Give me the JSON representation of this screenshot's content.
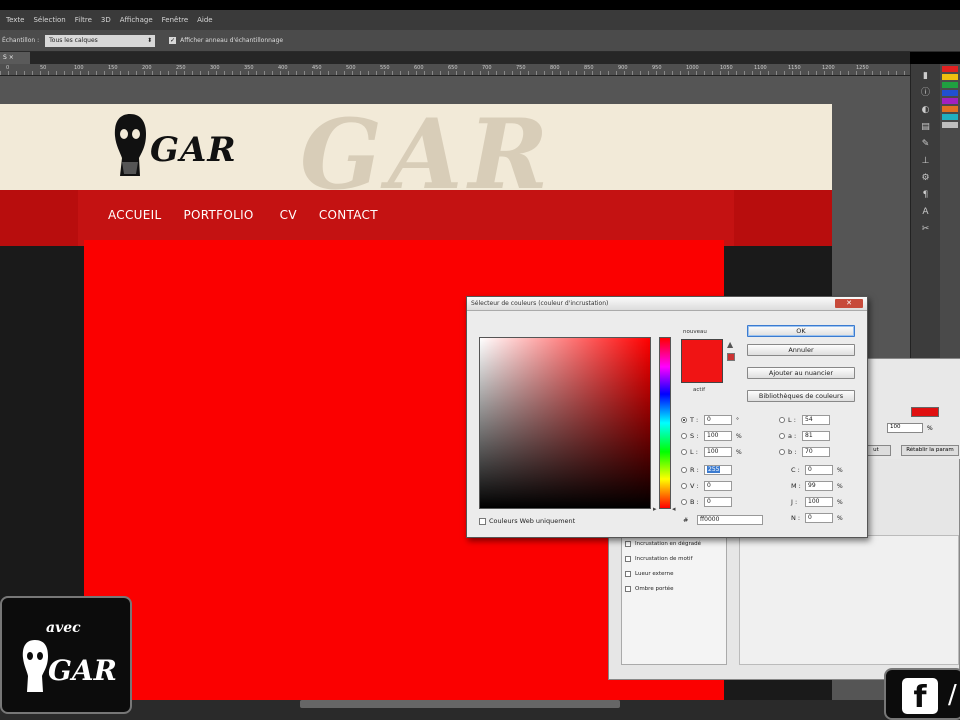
{
  "menubar": [
    "Texte",
    "Sélection",
    "Filtre",
    "3D",
    "Affichage",
    "Fenêtre",
    "Aide"
  ],
  "options": {
    "sample_label": "Échantillon :",
    "sample_value": "Tous les calques",
    "show_ring_label": "Afficher anneau d'échantillonnage"
  },
  "ruler_ticks": [
    "0",
    "50",
    "100",
    "150",
    "200",
    "250",
    "300",
    "350",
    "400",
    "450",
    "500",
    "550",
    "600",
    "650",
    "700",
    "750",
    "800",
    "850",
    "900",
    "950",
    "1000",
    "1050",
    "1100",
    "1150",
    "1200",
    "1250"
  ],
  "site": {
    "ghost_text": "GAR",
    "logo_text": "GAR",
    "nav": [
      "ACCUEIL",
      "PORTFOLIO",
      "CV",
      "CONTACT"
    ]
  },
  "picker": {
    "title": "Sélecteur de couleurs (couleur d'incrustation)",
    "label_new": "nouveau",
    "label_current": "actif",
    "new_color": "#f01414",
    "buttons": {
      "ok": "OK",
      "cancel": "Annuler",
      "add_swatch": "Ajouter au nuancier",
      "libraries": "Bibliothèques de couleurs"
    },
    "fields": {
      "T": {
        "letter": "T :",
        "value": "0",
        "unit": "°"
      },
      "S": {
        "letter": "S :",
        "value": "100",
        "unit": "%"
      },
      "Lum": {
        "letter": "L :",
        "value": "100",
        "unit": "%"
      },
      "R": {
        "letter": "R :",
        "value": "255"
      },
      "V": {
        "letter": "V :",
        "value": "0"
      },
      "B": {
        "letter": "B :",
        "value": "0"
      },
      "L": {
        "letter": "L :",
        "value": "54"
      },
      "a": {
        "letter": "a :",
        "value": "81"
      },
      "b": {
        "letter": "b :",
        "value": "70"
      },
      "C": {
        "letter": "C :",
        "value": "0",
        "unit": "%"
      },
      "M": {
        "letter": "M :",
        "value": "99",
        "unit": "%"
      },
      "J": {
        "letter": "J :",
        "value": "100",
        "unit": "%"
      },
      "N": {
        "letter": "N :",
        "value": "0",
        "unit": "%"
      }
    },
    "hex_prefix": "#",
    "hex_value": "ff0000",
    "web_only": "Couleurs Web uniquement"
  },
  "style_dialog": {
    "list": [
      "Incrustation en dégradé",
      "Incrustation de motif",
      "Lueur externe",
      "Ombre portée"
    ],
    "opacity_value": "100",
    "opacity_unit": "%",
    "btn_left": "ut",
    "btn_right": "Rétablir la param",
    "swatch_color": "#e01010"
  },
  "brand": {
    "avec": "avec",
    "gar": "GAR"
  },
  "social": {
    "fb": "f",
    "slash": "/"
  },
  "tab_label": "S"
}
